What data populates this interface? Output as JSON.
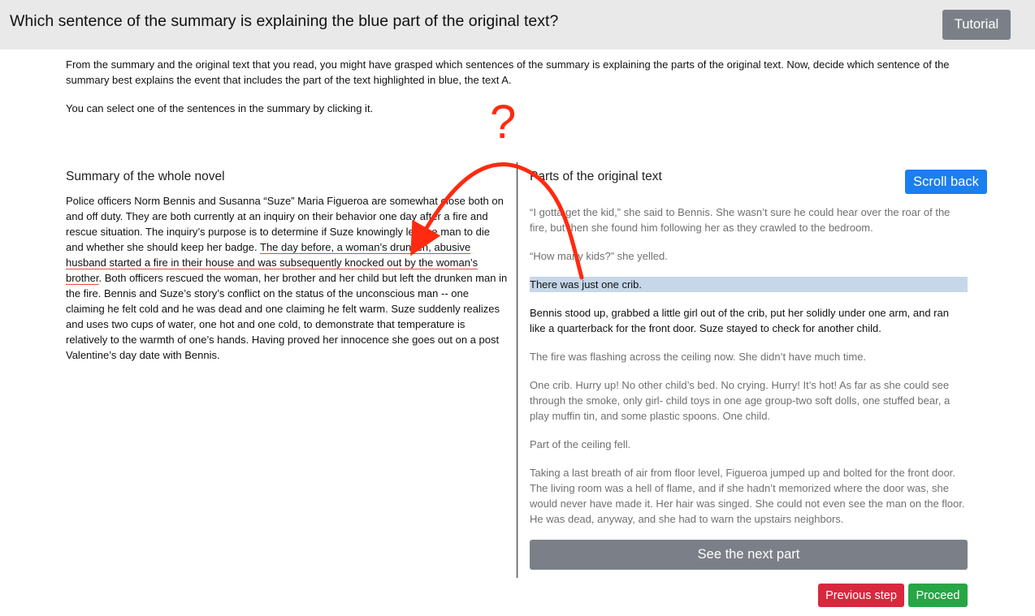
{
  "header": {
    "title": "Which sentence of the summary is explaining the blue part of the original text?",
    "tutorial_label": "Tutorial"
  },
  "intro": {
    "paragraph1": "From the summary and the original text that you read, you might have grasped which sentences of the summary is explaining the parts of the original text. Now, decide which sentence of the summary best explains the event that includes the part of the text highlighted in blue, the text A.",
    "paragraph2": "You can select one of the sentences in the summary by clicking it."
  },
  "summary": {
    "title": "Summary of the whole novel",
    "text_before": "Police officers Norm Bennis and Susanna “Suze” Maria Figueroa are somewhat close both on and off duty. They are both currently at an inquiry on their behavior one day after a fire and rescue situation. The inquiry’s purpose is to determine if Suze knowingly left the man to die and whether she should keep her badge. ",
    "selected_sentence": "The day before, a woman’s drunken, abusive husband started a fire in their house and was subsequently knocked out by the woman’s brother",
    "text_after": ". Both officers rescued the woman, her brother and her child but left the drunken man in the fire. Bennis and Suze’s story’s conflict on the status of the unconscious man -- one claiming he felt cold and he was dead and one claiming he felt warm. Suze suddenly realizes and uses two cups of water, one hot and one cold, to demonstrate that temperature is relatively to the warmth of one’s hands. Having proved her innocence she goes out on a post Valentine’s day date with Bennis."
  },
  "original": {
    "title": "Parts of the original text",
    "scroll_back_label": "Scroll back",
    "paragraphs": [
      "“I gotta get the kid,” she said to Bennis. She wasn’t sure he could hear over the roar of the fire, but then she found him following her as they crawled to the bedroom.",
      "“How many kids?” she yelled.",
      "There was just one crib.",
      "Bennis stood up, grabbed a little girl out of the crib, put her solidly under one arm, and ran like a quarterback for the front door. Suze stayed to check for another child.",
      "The fire was flashing across the ceiling now. She didn’t have much time.",
      "One crib. Hurry up! No other child’s bed. No crying. Hurry! It’s hot! As far as she could see through the smoke, only girl- child toys in one age group-two soft dolls, one stuffed bear, a play muffin tin, and some plastic spoons. One child.",
      "Part of the ceiling fell.",
      "Taking a last breath of air from floor level, Figueroa jumped up and bolted for the front door. The living room was a hell of flame, and if she hadn’t memorized where the door was, she would never have made it. Her hair was singed. She could not even see the man on the floor. He was dead, anyway, and she had to warn the upstairs neighbors."
    ],
    "next_part_label": "See the next part"
  },
  "footer": {
    "previous_label": "Previous step",
    "proceed_label": "Proceed"
  },
  "annotation": {
    "question_mark": "?",
    "color": "#ff2a10"
  },
  "colors": {
    "highlight": "#c7d7ea",
    "primary": "#1a7ff0",
    "secondary": "#7b8088",
    "danger": "#d9283d",
    "success": "#27a646"
  }
}
